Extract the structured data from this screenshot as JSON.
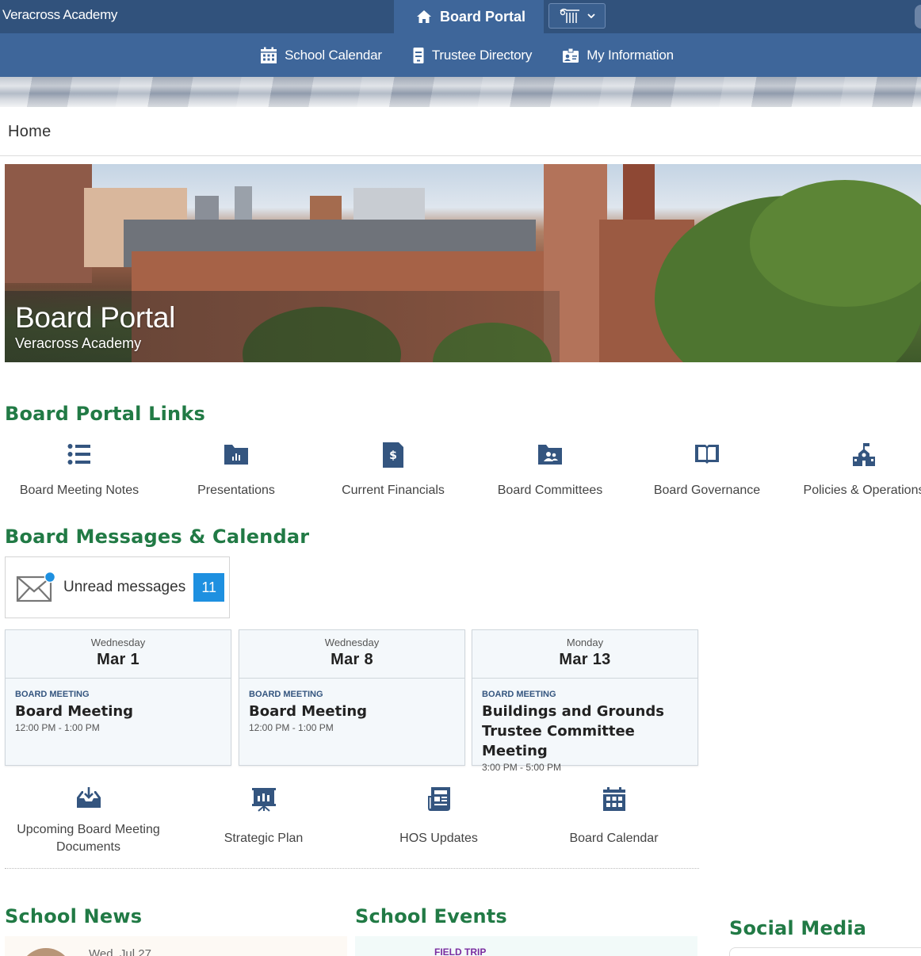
{
  "header": {
    "brand": "Veracross Academy",
    "portal_tab": "Board Portal"
  },
  "nav": [
    {
      "label": "School Calendar",
      "icon": "calendar-icon"
    },
    {
      "label": "Trustee Directory",
      "icon": "directory-icon"
    },
    {
      "label": "My Information",
      "icon": "id-card-icon"
    }
  ],
  "breadcrumb": "Home",
  "hero": {
    "title": "Board Portal",
    "subtitle": "Veracross Academy"
  },
  "links_section": {
    "title": "Board Portal Links",
    "items": [
      {
        "label": "Board Meeting Notes",
        "icon": "list-icon"
      },
      {
        "label": "Presentations",
        "icon": "chart-folder-icon"
      },
      {
        "label": "Current Financials",
        "icon": "dollar-document-icon"
      },
      {
        "label": "Board Committees",
        "icon": "people-folder-icon"
      },
      {
        "label": "Board Governance",
        "icon": "book-icon"
      },
      {
        "label": "Policies & Operations",
        "icon": "school-icon"
      }
    ]
  },
  "messages_section": {
    "title": "Board Messages & Calendar",
    "unread_label": "Unread messages",
    "unread_count": "11"
  },
  "events": [
    {
      "dow": "Wednesday",
      "date": "Mar 1",
      "category": "BOARD MEETING",
      "title": "Board Meeting",
      "time": "12:00 PM - 1:00 PM"
    },
    {
      "dow": "Wednesday",
      "date": "Mar 8",
      "category": "BOARD MEETING",
      "title": "Board Meeting",
      "time": "12:00 PM - 1:00 PM"
    },
    {
      "dow": "Monday",
      "date": "Mar 13",
      "category": "BOARD MEETING",
      "title": "Buildings and Grounds Trustee Committee Meeting",
      "time": "3:00 PM - 5:00 PM"
    }
  ],
  "docs": [
    {
      "label": "Upcoming Board Meeting Documents",
      "icon": "inbox-download-icon"
    },
    {
      "label": "Strategic Plan",
      "icon": "presentation-icon"
    },
    {
      "label": "HOS Updates",
      "icon": "newsletter-icon"
    },
    {
      "label": "Board Calendar",
      "icon": "calendar-icon"
    }
  ],
  "news_section": {
    "title": "School News",
    "date": "Wed, Jul 27"
  },
  "school_events_section": {
    "title": "School Events",
    "category": "FIELD TRIP"
  },
  "social_section": {
    "title": "Social Media"
  },
  "colors": {
    "header": "#31527c",
    "nav": "#3e669a",
    "section_title": "#217a45",
    "badge": "#1e90e0",
    "icon": "#34557f"
  }
}
